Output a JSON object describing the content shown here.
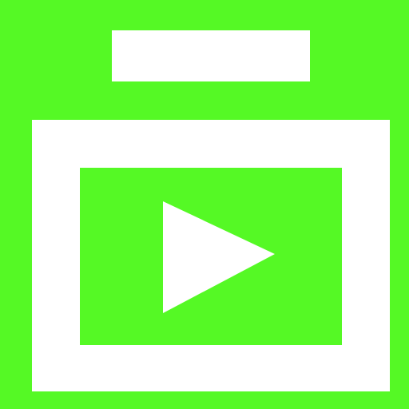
{
  "icon": {
    "name": "video-playlist-icon",
    "background_color": "#55F925",
    "foreground_color": "#FFFFFF"
  }
}
